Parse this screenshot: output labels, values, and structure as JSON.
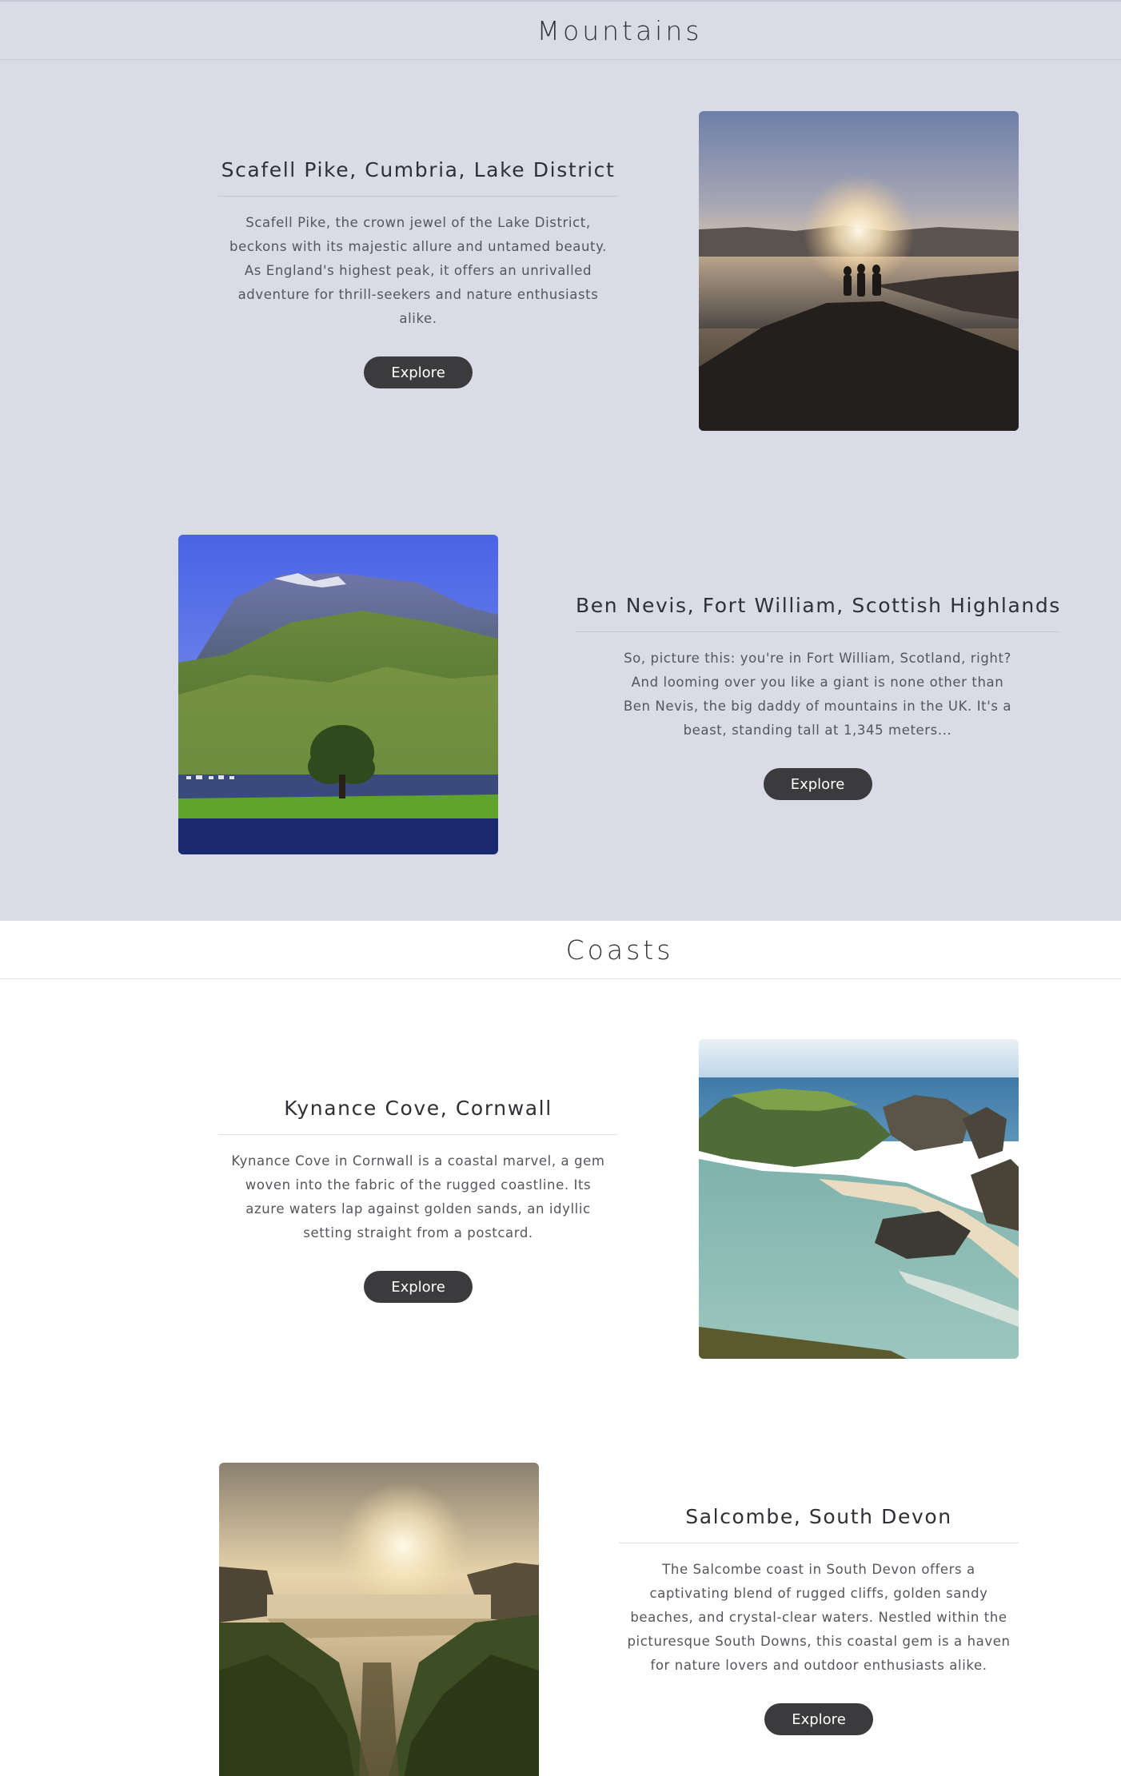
{
  "mountains": {
    "title": "Mountains",
    "cards": [
      {
        "title": "Scafell Pike, Cumbria, Lake District",
        "description": "Scafell Pike, the crown jewel of the Lake District, beckons with its majestic allure and untamed beauty. As England's highest peak, it offers an unrivalled adventure for thrill-seekers and nature enthusiasts alike.",
        "button": "Explore",
        "image": "sunset-mountain-hikers-photo"
      },
      {
        "title": "Ben Nevis, Fort William, Scottish Highlands",
        "description": "So, picture this: you're in Fort William, Scotland, right? And looming over you like a giant is none other than Ben Nevis, the big daddy of mountains in the UK. It's a beast, standing tall at 1,345 meters...",
        "button": "Explore",
        "image": "ben-nevis-mountain-photo"
      }
    ]
  },
  "coasts": {
    "title": "Coasts",
    "cards": [
      {
        "title": "Kynance Cove, Cornwall",
        "description": "Kynance Cove in Cornwall is a coastal marvel, a gem woven into the fabric of the rugged coastline. Its azure waters lap against golden sands, an idyllic setting straight from a postcard.",
        "button": "Explore",
        "image": "kynance-cove-photo"
      },
      {
        "title": "Salcombe, South Devon",
        "description": "The Salcombe coast in South Devon offers a captivating blend of rugged cliffs, golden sandy beaches, and crystal-clear waters. Nestled within the picturesque South Downs, this coastal gem is a haven for nature lovers and outdoor enthusiasts alike.",
        "button": "Explore",
        "image": "salcombe-sunset-valley-photo"
      }
    ]
  },
  "colors": {
    "mountains_bg": "#d9dbe7",
    "coasts_bg": "#ffffff",
    "button_bg": "#3b3b3d",
    "button_text": "#ffffff"
  }
}
